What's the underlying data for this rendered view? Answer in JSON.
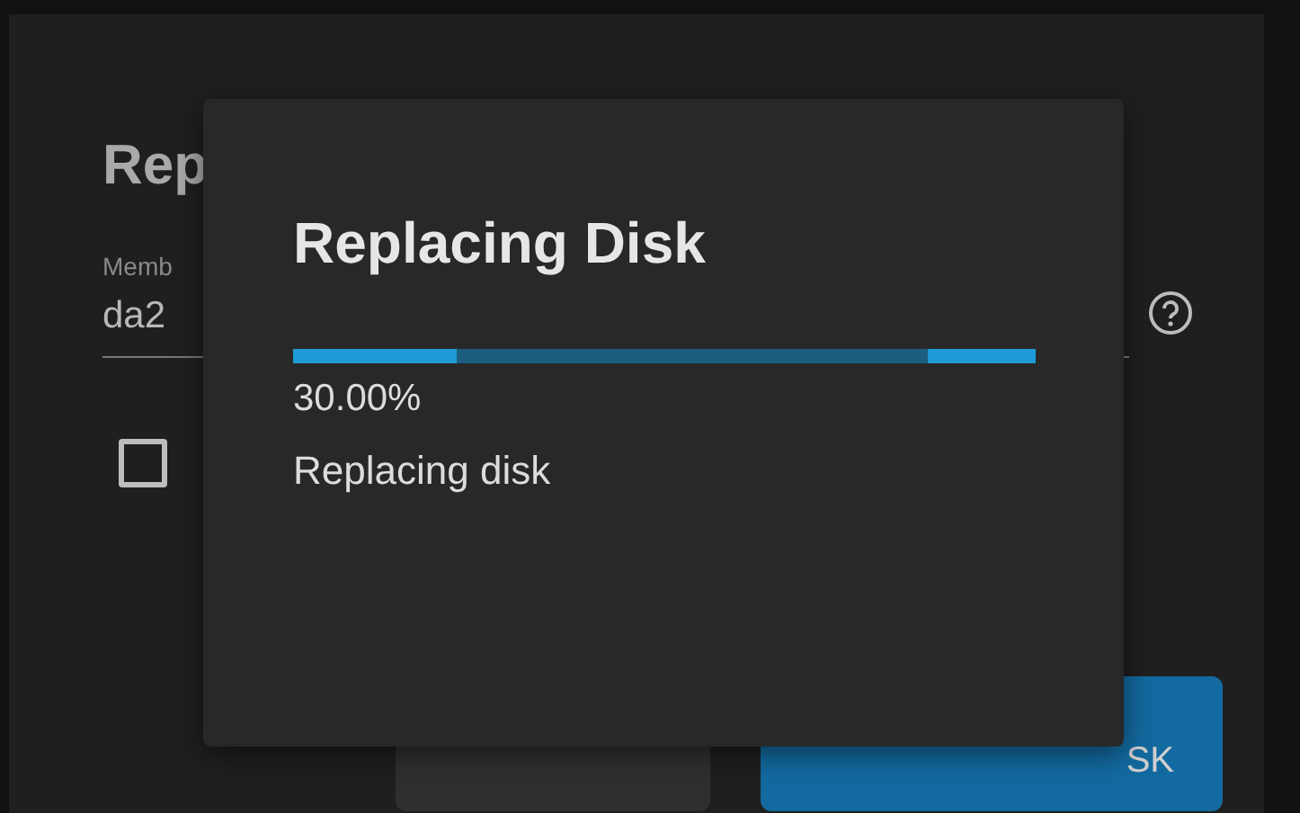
{
  "back_dialog": {
    "title": "Rep",
    "member_field": {
      "label": "Memb",
      "value": "da2"
    },
    "checkbox": {
      "checked": false
    },
    "buttons": [
      {
        "kind": "secondary"
      },
      {
        "kind": "primary",
        "label": "SK"
      }
    ]
  },
  "progress_dialog": {
    "title": "Replacing Disk",
    "level": 0.22,
    "percent": "30.00%",
    "message": "Replacing disk"
  }
}
